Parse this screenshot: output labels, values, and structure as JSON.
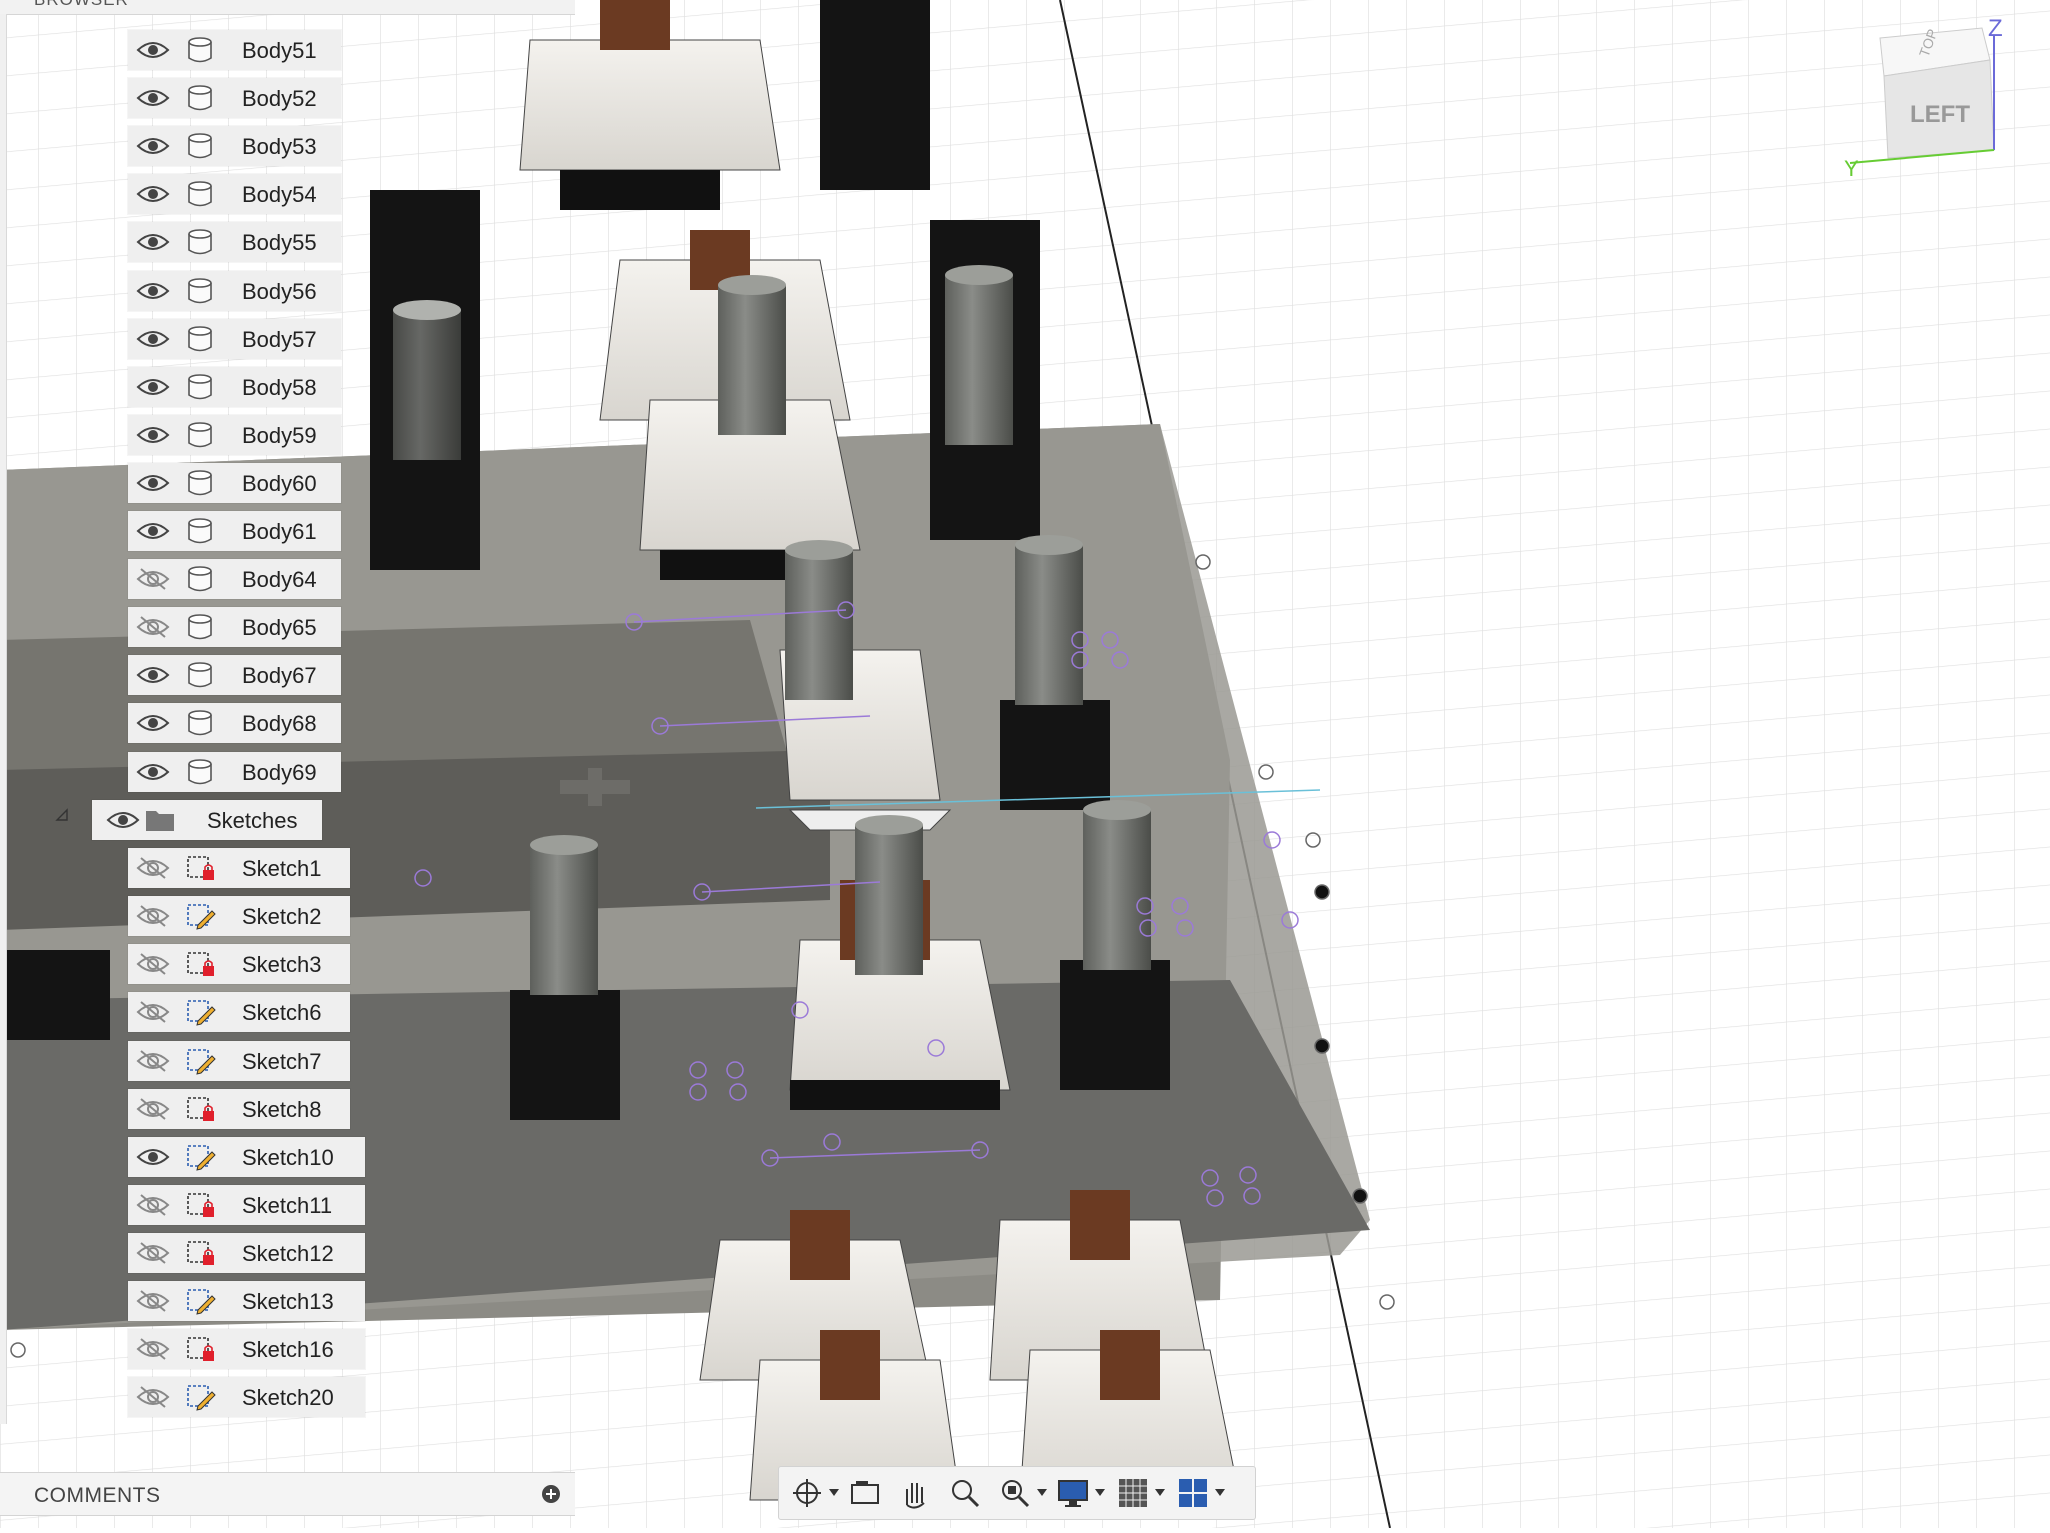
{
  "browser": {
    "header_label": "BROWSER",
    "bodies": [
      {
        "label": "Body51",
        "visible": true
      },
      {
        "label": "Body52",
        "visible": true
      },
      {
        "label": "Body53",
        "visible": true
      },
      {
        "label": "Body54",
        "visible": true
      },
      {
        "label": "Body55",
        "visible": true
      },
      {
        "label": "Body56",
        "visible": true
      },
      {
        "label": "Body57",
        "visible": true
      },
      {
        "label": "Body58",
        "visible": true
      },
      {
        "label": "Body59",
        "visible": true
      },
      {
        "label": "Body60",
        "visible": true
      },
      {
        "label": "Body61",
        "visible": true
      },
      {
        "label": "Body64",
        "visible": false
      },
      {
        "label": "Body65",
        "visible": false
      },
      {
        "label": "Body67",
        "visible": true
      },
      {
        "label": "Body68",
        "visible": true
      },
      {
        "label": "Body69",
        "visible": true
      }
    ],
    "sketches_folder": {
      "label": "Sketches",
      "visible": true
    },
    "sketches": [
      {
        "label": "Sketch1",
        "visible": false,
        "icon": "sketch-locked-icon"
      },
      {
        "label": "Sketch2",
        "visible": false,
        "icon": "sketch-edit-icon"
      },
      {
        "label": "Sketch3",
        "visible": false,
        "icon": "sketch-locked-icon"
      },
      {
        "label": "Sketch6",
        "visible": false,
        "icon": "sketch-edit-icon"
      },
      {
        "label": "Sketch7",
        "visible": false,
        "icon": "sketch-edit-icon"
      },
      {
        "label": "Sketch8",
        "visible": false,
        "icon": "sketch-locked-icon"
      },
      {
        "label": "Sketch10",
        "visible": true,
        "icon": "sketch-edit-icon"
      },
      {
        "label": "Sketch11",
        "visible": false,
        "icon": "sketch-locked-icon"
      },
      {
        "label": "Sketch12",
        "visible": false,
        "icon": "sketch-locked-icon"
      },
      {
        "label": "Sketch13",
        "visible": false,
        "icon": "sketch-edit-icon"
      },
      {
        "label": "Sketch16",
        "visible": false,
        "icon": "sketch-locked-icon"
      },
      {
        "label": "Sketch20",
        "visible": false,
        "icon": "sketch-edit-icon"
      }
    ]
  },
  "comments": {
    "label": "COMMENTS"
  },
  "viewcube": {
    "face_front": "LEFT",
    "face_top": "TOP",
    "axis_z": "Z",
    "axis_y": "Y"
  },
  "toolbar": {
    "icons": [
      "orbit-icon",
      "look-at-icon",
      "pan-icon",
      "zoom-icon",
      "fit-icon",
      "display-settings-icon",
      "grid-icon",
      "viewports-icon"
    ]
  },
  "colors": {
    "panel_bg": "#efefef",
    "sketch_point": "#a070e0",
    "grid_line": "#dcdcdc",
    "plate": "#8d8d87",
    "accent_red": "#e0202c"
  }
}
